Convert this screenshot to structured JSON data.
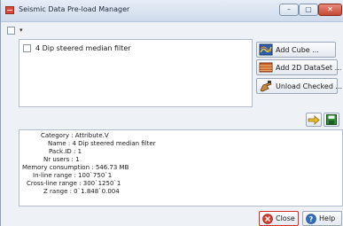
{
  "window": {
    "title": "Seismic Data Pre-load Manager",
    "controls": {
      "minimize": "–",
      "maximize": "▢",
      "close": "✕"
    }
  },
  "toolbar": {
    "select_all_checked": false
  },
  "list": {
    "items": [
      {
        "label": "4 Dip steered median filter",
        "checked": false
      }
    ]
  },
  "side_buttons": {
    "add_cube": "Add Cube ...",
    "add_2d_dataset": "Add 2D DataSet ...",
    "unload_checked": "Unload Checked ..."
  },
  "icons": {
    "app": "seismic-app-icon",
    "add_cube": "cube-icon",
    "add_2d": "dataset-2d-icon",
    "unload": "unload-hand-icon",
    "arrow": "right-arrow-icon",
    "save": "save-icon",
    "close": "close-circle-icon",
    "help": "help-circle-icon"
  },
  "info": {
    "category": "Category : Attribute.V",
    "name": "Name : 4 Dip steered median filter",
    "pack_id": "Pack.ID : 1",
    "nr_users": "Nr users : 1",
    "memory": "Memory consumption : 546.73 MB",
    "inline_range": "In-line range : 100`750`1",
    "crossline_range": "Cross-line range : 300`1250`1",
    "z_range": "Z range : 0`1.848`0.004"
  },
  "bottom_buttons": {
    "close": "Close",
    "help": "Help"
  },
  "colors": {
    "close_highlight": "#d0302a",
    "titlebar": "#cfdbeb",
    "panel_bg": "#eef1f5"
  }
}
